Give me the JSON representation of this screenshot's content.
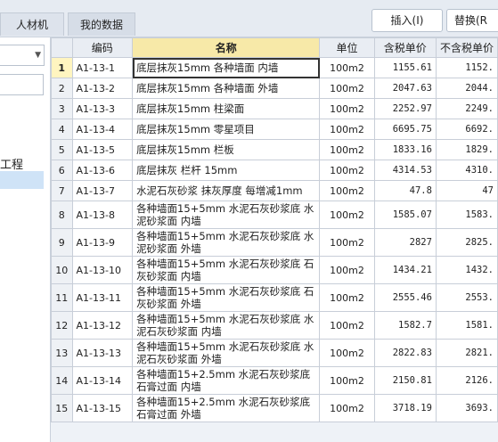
{
  "tabs": [
    {
      "label": "人材机"
    },
    {
      "label": "我的数据"
    }
  ],
  "toolbar": {
    "insert_label": "插入(I)",
    "replace_label": "替换(R"
  },
  "left": {
    "tree_text": "工程"
  },
  "columns": {
    "code": "编码",
    "name": "名称",
    "unit": "单位",
    "tax_price": "含税单价",
    "notax_price": "不含税单价"
  },
  "rows": [
    {
      "no": "1",
      "code": "A1-13-1",
      "name": "底层抹灰15mm 各种墙面 内墙",
      "unit": "100m2",
      "tax": "1155.61",
      "notax": "1152."
    },
    {
      "no": "2",
      "code": "A1-13-2",
      "name": "底层抹灰15mm 各种墙面 外墙",
      "unit": "100m2",
      "tax": "2047.63",
      "notax": "2044."
    },
    {
      "no": "3",
      "code": "A1-13-3",
      "name": "底层抹灰15mm 柱梁面",
      "unit": "100m2",
      "tax": "2252.97",
      "notax": "2249."
    },
    {
      "no": "4",
      "code": "A1-13-4",
      "name": "底层抹灰15mm 零星项目",
      "unit": "100m2",
      "tax": "6695.75",
      "notax": "6692."
    },
    {
      "no": "5",
      "code": "A1-13-5",
      "name": "底层抹灰15mm 栏板",
      "unit": "100m2",
      "tax": "1833.16",
      "notax": "1829."
    },
    {
      "no": "6",
      "code": "A1-13-6",
      "name": "底层抹灰 栏杆 15mm",
      "unit": "100m2",
      "tax": "4314.53",
      "notax": "4310."
    },
    {
      "no": "7",
      "code": "A1-13-7",
      "name": "水泥石灰砂浆 抹灰厚度 每增减1mm",
      "unit": "100m2",
      "tax": "47.8",
      "notax": "47"
    },
    {
      "no": "8",
      "code": "A1-13-8",
      "name": "各种墙面15+5mm 水泥石灰砂浆底 水泥砂浆面 内墙",
      "unit": "100m2",
      "tax": "1585.07",
      "notax": "1583."
    },
    {
      "no": "9",
      "code": "A1-13-9",
      "name": "各种墙面15+5mm 水泥石灰砂浆底 水泥砂浆面 外墙",
      "unit": "100m2",
      "tax": "2827",
      "notax": "2825."
    },
    {
      "no": "10",
      "code": "A1-13-10",
      "name": "各种墙面15+5mm 水泥石灰砂浆底 石灰砂浆面 内墙",
      "unit": "100m2",
      "tax": "1434.21",
      "notax": "1432."
    },
    {
      "no": "11",
      "code": "A1-13-11",
      "name": "各种墙面15+5mm 水泥石灰砂浆底 石灰砂浆面 外墙",
      "unit": "100m2",
      "tax": "2555.46",
      "notax": "2553."
    },
    {
      "no": "12",
      "code": "A1-13-12",
      "name": "各种墙面15+5mm 水泥石灰砂浆底 水泥石灰砂浆面 内墙",
      "unit": "100m2",
      "tax": "1582.7",
      "notax": "1581."
    },
    {
      "no": "13",
      "code": "A1-13-13",
      "name": "各种墙面15+5mm 水泥石灰砂浆底 水泥石灰砂浆面 外墙",
      "unit": "100m2",
      "tax": "2822.83",
      "notax": "2821."
    },
    {
      "no": "14",
      "code": "A1-13-14",
      "name": "各种墙面15+2.5mm 水泥石灰砂浆底 石膏过面 内墙",
      "unit": "100m2",
      "tax": "2150.81",
      "notax": "2126."
    },
    {
      "no": "15",
      "code": "A1-13-15",
      "name": "各种墙面15+2.5mm 水泥石灰砂浆底 石膏过面 外墙",
      "unit": "100m2",
      "tax": "3718.19",
      "notax": "3693."
    }
  ]
}
